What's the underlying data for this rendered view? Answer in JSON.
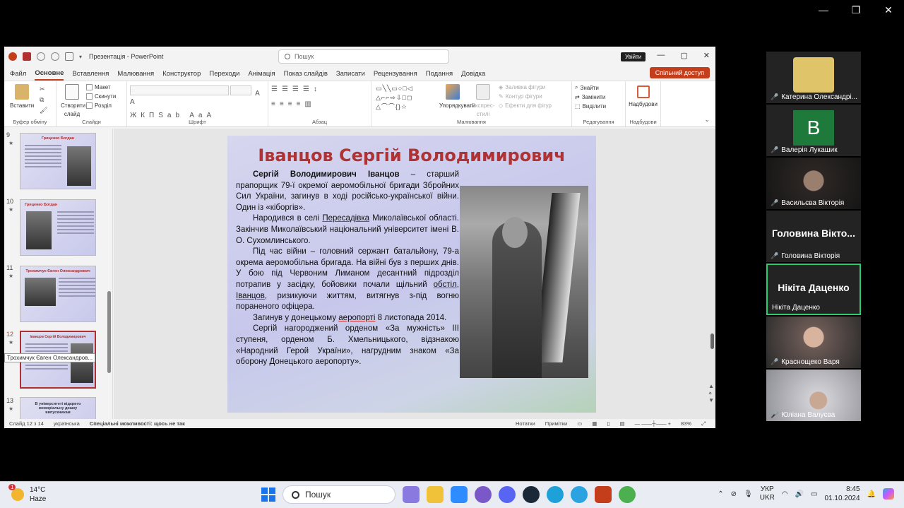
{
  "zoom_window": {
    "controls": [
      "—",
      "❐",
      "✕"
    ]
  },
  "ppt": {
    "doc_title": "Презентація  -  PowerPoint",
    "search_placeholder": "Пошук",
    "signin": "Увійти",
    "win_controls": [
      "—",
      "▢",
      "✕"
    ],
    "menu_tabs": [
      "Файл",
      "Основне",
      "Вставлення",
      "Малювання",
      "Конструктор",
      "Переходи",
      "Анімація",
      "Показ слайдів",
      "Записати",
      "Рецензування",
      "Подання",
      "Довідка"
    ],
    "active_tab": "Основне",
    "share": "Спільний доступ",
    "ribbon": {
      "paste": "Вставити",
      "clipboard_label": "Буфер обміну",
      "new_slide": "Створити слайд",
      "layout": "Макет",
      "reset": "Скинути",
      "sections": "Розділ",
      "slides_label": "Слайди",
      "font_label": "Шрифт",
      "paragraph_label": "Абзац",
      "arrange": "Упорядкувати",
      "quick_styles": "Експрес-стилі",
      "shape_fill": "Заливка фігури",
      "shape_outline": "Контур фігури",
      "shape_effects": "Ефекти для фігур",
      "drawing_label": "Малювання",
      "find": "Знайти",
      "replace": "Замінити",
      "select": "Виділити",
      "editing_label": "Редагування",
      "addins": "Надбудови",
      "addins_label": "Надбудови"
    },
    "thumbnails": [
      {
        "num": "9",
        "title": "Гриценко Богдан"
      },
      {
        "num": "10",
        "title": "Гриценко Богдан"
      },
      {
        "num": "11",
        "title": "Трохимчук Євген Олександрович"
      },
      {
        "num": "12",
        "title": "Іванцов Сергій Володимирович"
      },
      {
        "num": "13",
        "title": "В університеті відкрито меморіальну дошку випускникам"
      }
    ],
    "tooltip": "Трохимчук Євген Олександров...",
    "slide": {
      "title": "Іванцов Сергій Володимирович",
      "p1_bold": "Сергій Володимирович Іванцов",
      "p1_rest": " – старший прапорщик 79-ї окремої аеромобільної бригади Збройних Сил України, загинув в ході російсько-української війни. Один із «кіборгів».",
      "p2_a": "Народився в селі ",
      "p2_u": "Пересадівка",
      "p2_b": " Миколаївської області. Закінчив Миколаївський національний університет імені В. О. Сухомлинського.",
      "p3_a": "Під час війни – головний сержант батальйону, 79-а окрема аеромобільна бригада. На війні був з перших днів. У бою під Червоним Лиманом десантний підрозділ потрапив у засідку, бойовики почали щільний ",
      "p3_u1": "обстіл",
      "p3_b": ", ",
      "p3_u2": "Іванцов",
      "p3_c": ", ризикуючи життям, витягнув з-під вогню пораненого офіцера.",
      "p4_a": "Загинув у донецькому ",
      "p4_u": "аеропорті",
      "p4_b": " 8 листопада 2014.",
      "p5": "Сергій нагороджений орденом «За мужність» III ступеня, орденом Б. Хмельницького, відзнакою «Народний Герой України», нагрудним знаком «За оборону Донецького аеропорту»."
    },
    "status": {
      "slide_of": "Слайд 12 з 14",
      "language": "українська",
      "accessibility": "Спеціальні можливості: щось не так",
      "notes": "Нотатки",
      "comments": "Примітки",
      "zoom": "83%"
    }
  },
  "participants": [
    {
      "name": "Катерина Олександрі...",
      "type": "avatar",
      "color": "#e0c46a"
    },
    {
      "name": "Валерія Лукашик",
      "type": "letter",
      "letter": "В"
    },
    {
      "name": "Васильєва Вікторія",
      "type": "photo"
    },
    {
      "name": "Головина Вікторія",
      "type": "text",
      "big": "Головина Вікто..."
    },
    {
      "name": "Нікіта Даценко",
      "type": "text",
      "big": "Нікіта Даценко",
      "active": true
    },
    {
      "name": "Краснощеко Варя",
      "type": "photo"
    },
    {
      "name": "Юліана Валуєва",
      "type": "photo"
    }
  ],
  "taskbar": {
    "weather_temp": "14°C",
    "weather_desc": "Haze",
    "weather_badge": "1",
    "search": "Пошук",
    "lang1": "УКР",
    "lang2": "UKR",
    "time": "8:45",
    "date": "01.10.2024"
  }
}
